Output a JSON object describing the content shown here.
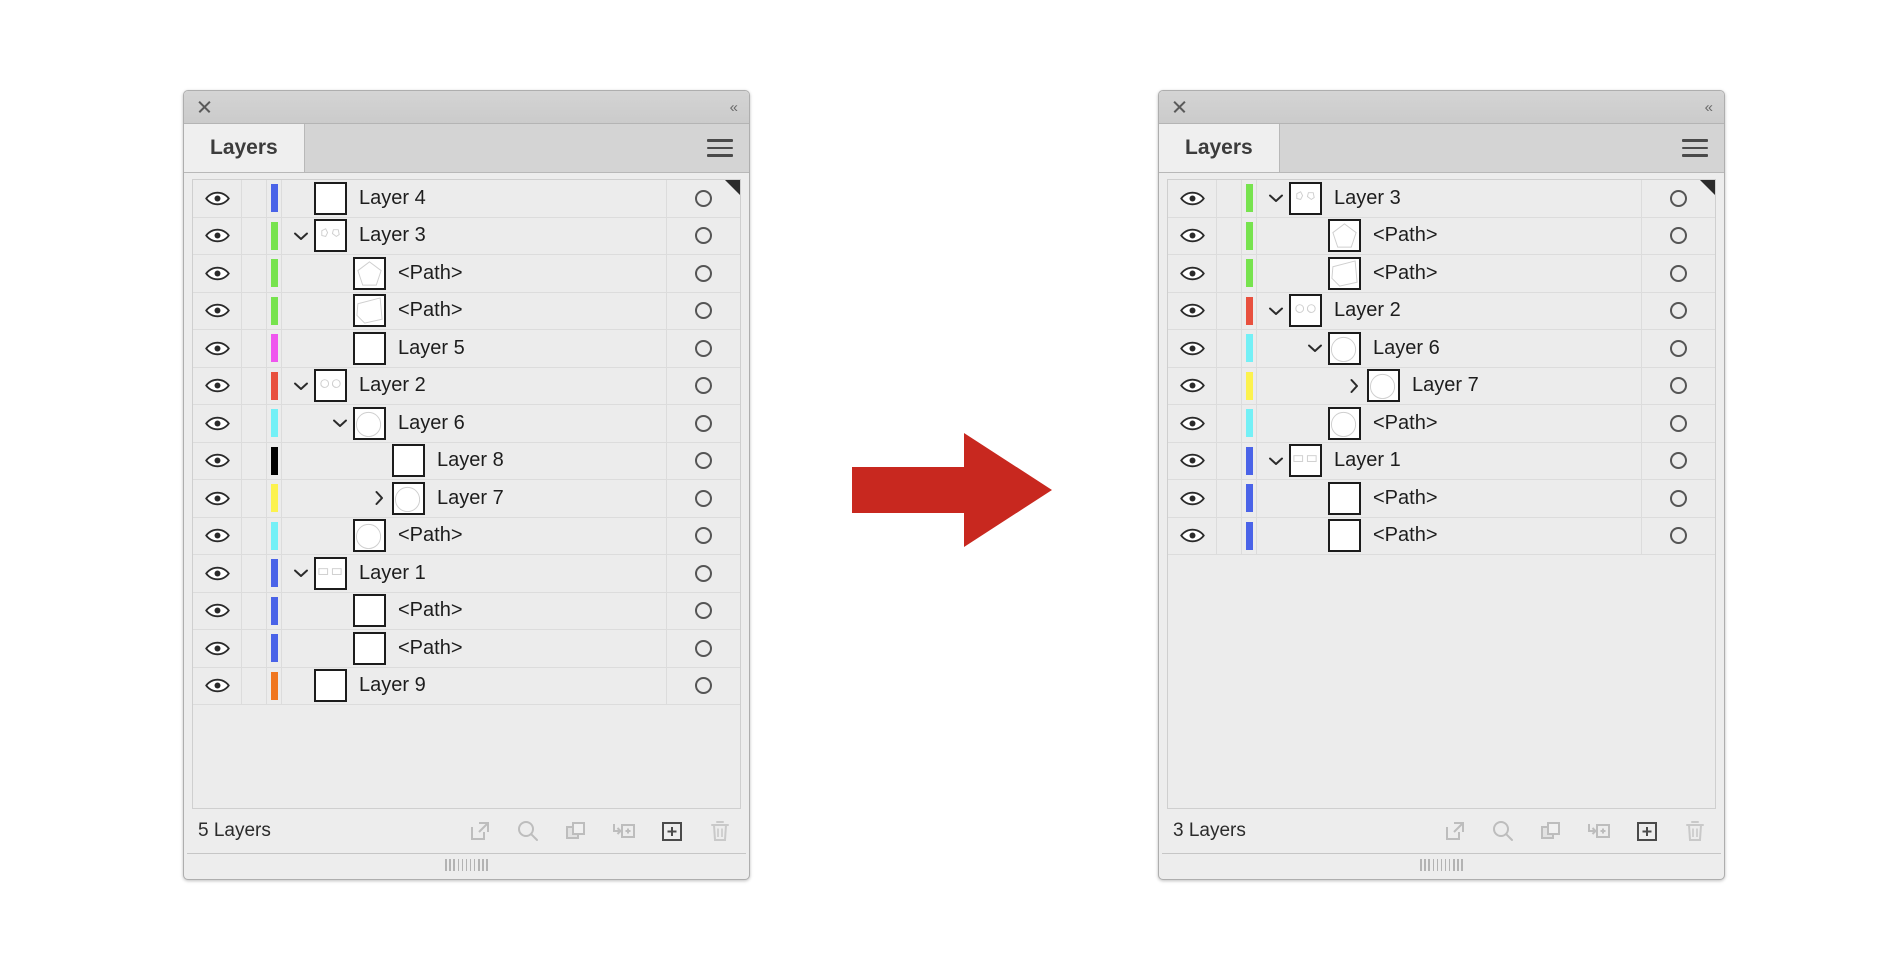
{
  "titlebar": {
    "close_icon": "close-icon",
    "collapse_label": "«"
  },
  "tab": {
    "label": "Layers",
    "menu_icon": "panel-menu-icon"
  },
  "colors": {
    "blue": "#4a63e8",
    "green": "#77e34e",
    "magenta": "#ef55ee",
    "red": "#e8503e",
    "cyan": "#74f0f6",
    "black": "#000000",
    "yellow": "#fcf24e",
    "orange": "#f0761f",
    "arrow_red": "#c8281f",
    "panel_bg": "#ececec",
    "title_bg": "#d0d0d0"
  },
  "footer_tools": [
    {
      "name": "release-to-layers-icon",
      "label": "Release to Layers"
    },
    {
      "name": "locate-object-icon",
      "label": "Locate Object"
    },
    {
      "name": "duplicate-selection-icon",
      "label": "Make/Release Clipping Mask"
    },
    {
      "name": "collect-in-new-layer-icon",
      "label": "Create New Sublayer"
    },
    {
      "name": "new-layer-icon",
      "label": "Create New Layer"
    },
    {
      "name": "delete-selection-icon",
      "label": "Delete Selection"
    }
  ],
  "left_panel": {
    "count_label": "5 Layers",
    "rows": [
      {
        "label": "Layer 4",
        "color": "blue",
        "indent": 0,
        "disclosure": "none",
        "thumb": "blank"
      },
      {
        "label": "Layer 3",
        "color": "green",
        "indent": 0,
        "disclosure": "expanded",
        "thumb": "two-shapes"
      },
      {
        "label": "<Path>",
        "color": "green",
        "indent": 1,
        "disclosure": "none",
        "thumb": "pentagon"
      },
      {
        "label": "<Path>",
        "color": "green",
        "indent": 1,
        "disclosure": "none",
        "thumb": "pentagon2"
      },
      {
        "label": "Layer 5",
        "color": "magenta",
        "indent": 1,
        "disclosure": "none",
        "thumb": "blank"
      },
      {
        "label": "Layer 2",
        "color": "red",
        "indent": 0,
        "disclosure": "expanded",
        "thumb": "two-circles"
      },
      {
        "label": "Layer 6",
        "color": "cyan",
        "indent": 1,
        "disclosure": "expanded",
        "thumb": "circle"
      },
      {
        "label": "Layer 8",
        "color": "black",
        "indent": 2,
        "disclosure": "none",
        "thumb": "blank"
      },
      {
        "label": "Layer 7",
        "color": "yellow",
        "indent": 2,
        "disclosure": "collapsed",
        "thumb": "circle"
      },
      {
        "label": "<Path>",
        "color": "cyan",
        "indent": 1,
        "disclosure": "none",
        "thumb": "circle"
      },
      {
        "label": "Layer 1",
        "color": "blue",
        "indent": 0,
        "disclosure": "expanded",
        "thumb": "two-rects"
      },
      {
        "label": "<Path>",
        "color": "blue",
        "indent": 1,
        "disclosure": "none",
        "thumb": "blank"
      },
      {
        "label": "<Path>",
        "color": "blue",
        "indent": 1,
        "disclosure": "none",
        "thumb": "blank"
      },
      {
        "label": "Layer 9",
        "color": "orange",
        "indent": 0,
        "disclosure": "none",
        "thumb": "blank"
      }
    ]
  },
  "right_panel": {
    "count_label": "3 Layers",
    "rows": [
      {
        "label": "Layer 3",
        "color": "green",
        "indent": 0,
        "disclosure": "expanded",
        "thumb": "two-shapes"
      },
      {
        "label": "<Path>",
        "color": "green",
        "indent": 1,
        "disclosure": "none",
        "thumb": "pentagon"
      },
      {
        "label": "<Path>",
        "color": "green",
        "indent": 1,
        "disclosure": "none",
        "thumb": "pentagon2"
      },
      {
        "label": "Layer 2",
        "color": "red",
        "indent": 0,
        "disclosure": "expanded",
        "thumb": "two-circles"
      },
      {
        "label": "Layer 6",
        "color": "cyan",
        "indent": 1,
        "disclosure": "expanded",
        "thumb": "circle"
      },
      {
        "label": "Layer 7",
        "color": "yellow",
        "indent": 2,
        "disclosure": "collapsed",
        "thumb": "circle"
      },
      {
        "label": "<Path>",
        "color": "cyan",
        "indent": 1,
        "disclosure": "none",
        "thumb": "circle"
      },
      {
        "label": "Layer 1",
        "color": "blue",
        "indent": 0,
        "disclosure": "expanded",
        "thumb": "two-rects"
      },
      {
        "label": "<Path>",
        "color": "blue",
        "indent": 1,
        "disclosure": "none",
        "thumb": "blank"
      },
      {
        "label": "<Path>",
        "color": "blue",
        "indent": 1,
        "disclosure": "none",
        "thumb": "blank"
      }
    ]
  },
  "arrow": {
    "name": "right-arrow-icon"
  }
}
